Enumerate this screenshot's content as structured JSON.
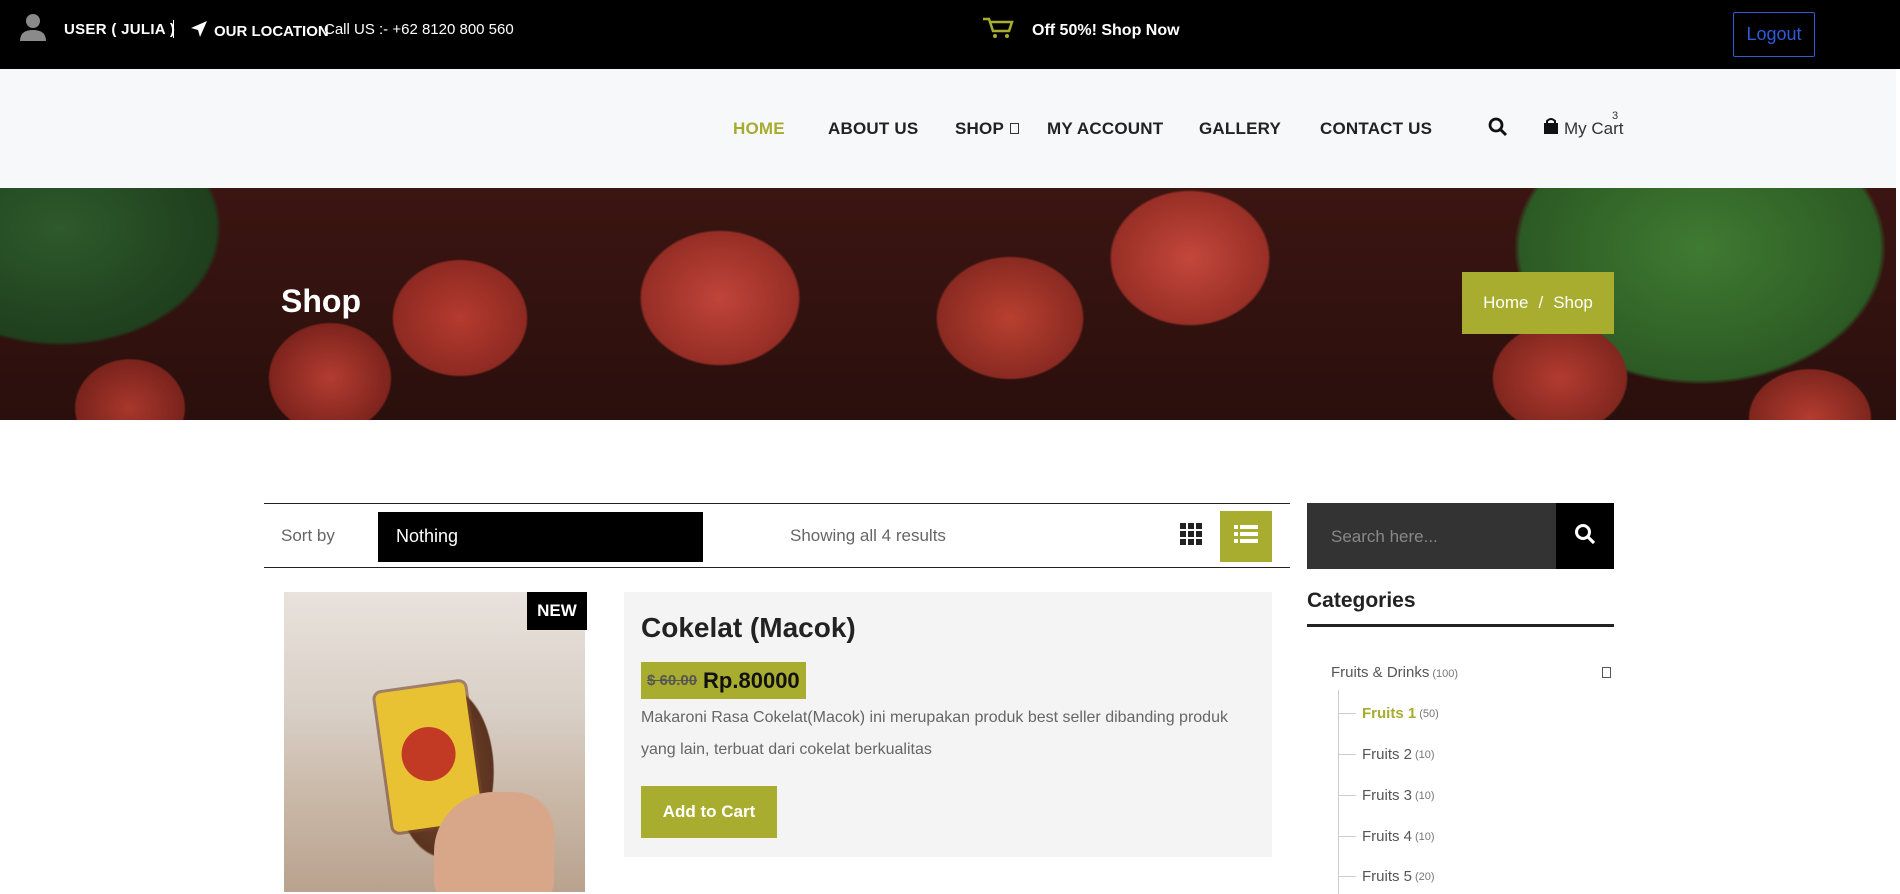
{
  "topbar": {
    "user": "USER ( JULIA )",
    "location": "OUR LOCATION",
    "call": "Call US :- +62 8120 800 560",
    "promo": "Off 50%! Shop Now",
    "logout": "Logout"
  },
  "nav": {
    "items": [
      "HOME",
      "ABOUT US",
      "SHOP",
      "MY ACCOUNT",
      "GALLERY",
      "CONTACT US"
    ],
    "active": "HOME",
    "cart_label": "My Cart",
    "cart_count": "3"
  },
  "banner": {
    "title": "Shop",
    "breadcrumb": [
      "Home",
      "Shop"
    ],
    "separator": "/"
  },
  "toolbar": {
    "sort_label": "Sort by",
    "sort_value": "Nothing",
    "showing": "Showing all 4 results"
  },
  "product": {
    "badge": "NEW",
    "name": "Cokelat (Macok)",
    "old_price": "$ 60.00",
    "price": "Rp.80000",
    "description": "Makaroni Rasa Cokelat(Macok) ini merupakan produk best seller dibanding produk yang lain, terbuat dari cokelat berkualitas",
    "add_to_cart": "Add to Cart"
  },
  "sidebar": {
    "search_placeholder": "Search here...",
    "categories_title": "Categories",
    "root": {
      "label": "Fruits & Drinks",
      "count": "(100)"
    },
    "children": [
      {
        "label": "Fruits 1",
        "count": "(50)"
      },
      {
        "label": "Fruits 2",
        "count": "(10)"
      },
      {
        "label": "Fruits 3",
        "count": "(10)"
      },
      {
        "label": "Fruits 4",
        "count": "(10)"
      },
      {
        "label": "Fruits 5",
        "count": "(20)"
      }
    ]
  },
  "colors": {
    "accent": "#a8ad2f",
    "topbar": "#000000",
    "logout_border": "#2f5bd8"
  }
}
